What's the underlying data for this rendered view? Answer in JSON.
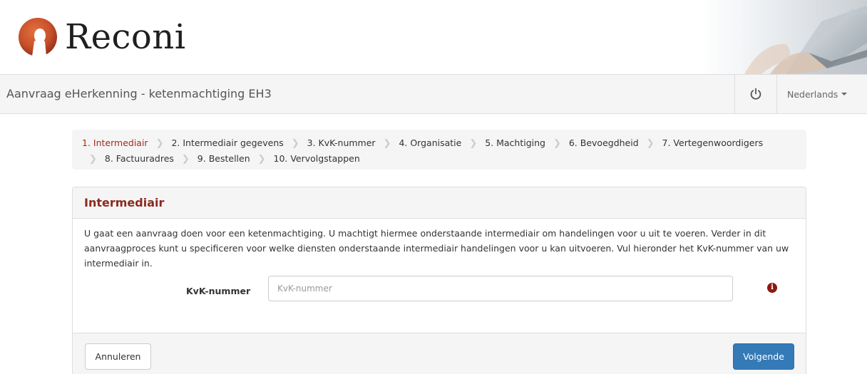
{
  "brand": {
    "logo_text": "Reconi",
    "logo_colors": {
      "orb": "#c8502a",
      "orb_dark": "#8f2c18"
    }
  },
  "navbar": {
    "title": "Aanvraag eHerkenning - ketenmachtiging EH3",
    "power_icon": "power-icon",
    "language": "Nederlands"
  },
  "breadcrumb": {
    "steps": [
      "1. Intermediair",
      "2. Intermediair gegevens",
      "3. KvK-nummer",
      "4. Organisatie",
      "5. Machtiging",
      "6. Bevoegdheid",
      "7. Vertegenwoordigers",
      "8. Factuuradres",
      "9. Bestellen",
      "10. Vervolgstappen"
    ],
    "active_index": 0
  },
  "panel": {
    "title": "Intermediair",
    "description": "U gaat een aanvraag doen voor een ketenmachtiging. U machtigt hiermee onderstaande intermediair om handelingen voor u uit te voeren. Verder in dit aanvraagproces kunt u specificeren voor welke diensten onderstaande intermediair handelingen voor u kan uitvoeren. Vul hieronder het KvK-nummer van uw intermediair in.",
    "field_label": "KvK-nummer",
    "field_value": "",
    "field_placeholder": "KvK-nummer",
    "info_icon_glyph": "i"
  },
  "footer": {
    "cancel_label": "Annuleren",
    "next_label": "Volgende"
  },
  "colors": {
    "accent_red": "#a42a1b",
    "panel_title": "#8b2a1f",
    "primary_button": "#337ab7"
  }
}
